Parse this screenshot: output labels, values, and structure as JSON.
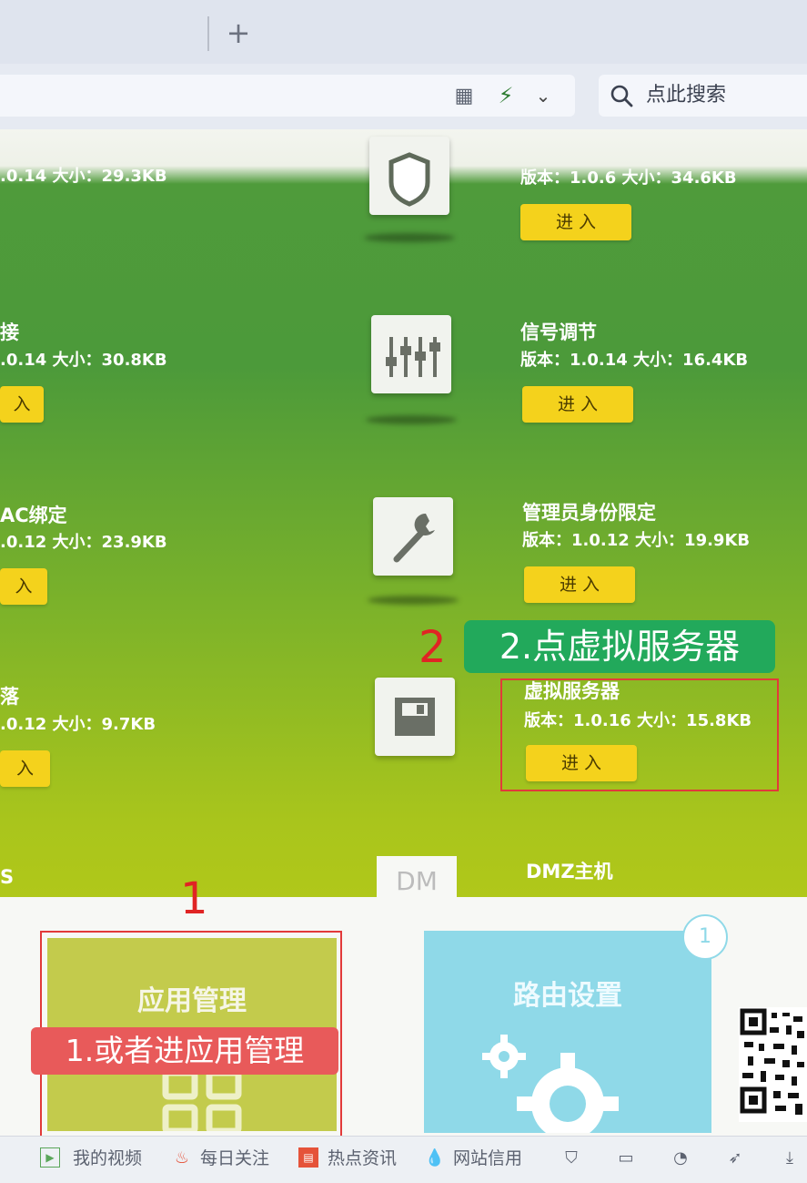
{
  "browser": {
    "new_tab": "+",
    "search_placeholder": "点此搜索"
  },
  "icons": {
    "qr": "qr-code-icon",
    "bolt": "bolt-icon",
    "chevron": "chevron-down-icon",
    "search": "search-icon"
  },
  "left_column": [
    {
      "name": "",
      "info": ".0.14 大小：29.3KB"
    },
    {
      "name": "接",
      "info": ".0.14 大小：30.8KB"
    },
    {
      "name": "AC绑定",
      "info": ".0.12 大小：23.9KB"
    },
    {
      "name": "落",
      "info": ".0.12 大小：9.7KB"
    },
    {
      "name": "S",
      "info": ""
    }
  ],
  "left_enter_label": "入",
  "right_column": [
    {
      "name": "",
      "info": "版本：1.0.6 大小：34.6KB",
      "enter": "进 入"
    },
    {
      "name": "信号调节",
      "info": "版本：1.0.14 大小：16.4KB",
      "enter": "进 入"
    },
    {
      "name": "管理员身份限定",
      "info": "版本：1.0.12 大小：19.9KB",
      "enter": "进 入"
    },
    {
      "name": "虚拟服务器",
      "info": "版本：1.0.16 大小：15.8KB",
      "enter": "进 入"
    },
    {
      "name": "DMZ主机",
      "info": "",
      "enter": ""
    }
  ],
  "dm_tab": "DM",
  "cards": {
    "app_management": "应用管理",
    "route_settings": "路由设置",
    "route_badge": "1"
  },
  "annotations": {
    "step1_number": "1",
    "step1_label": "1.或者进应用管理",
    "step2_number": "2",
    "step2_label": "2.点虚拟服务器",
    "color_red": "#e23a3a",
    "color_green": "#22a95b"
  },
  "statusbar": {
    "my_videos": "我的视频",
    "daily_follow": "每日关注",
    "hot_news": "热点资讯",
    "site_credit": "网站信用"
  },
  "colors": {
    "page_green": "#4f9b3b",
    "button_yellow": "#f4d21c",
    "app_card": "#c3cb4c",
    "route_card": "#8fd9e8"
  }
}
